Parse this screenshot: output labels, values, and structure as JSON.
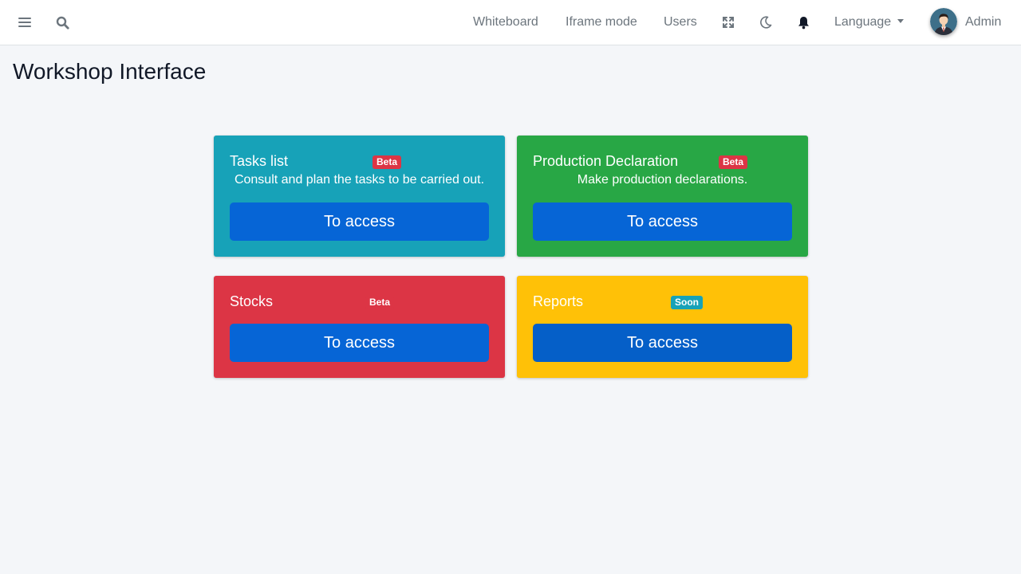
{
  "colors": {
    "info": "#17a2b8",
    "success": "#28a745",
    "danger": "#dc3545",
    "warning": "#ffc107",
    "primary_button": "#0665d6",
    "primary_button_dark": "#055fc8"
  },
  "navbar": {
    "menu_icon": "hamburger-icon",
    "search_icon": "search-icon",
    "links": [
      "Whiteboard",
      "Iframe mode",
      "Users"
    ],
    "fullscreen_icon": "expand-icon",
    "dark_mode_icon": "moon-icon",
    "notifications_icon": "bell-icon",
    "language_label": "Language",
    "user_name": "Admin"
  },
  "page": {
    "title": "Workshop Interface"
  },
  "cards": [
    {
      "title": "Tasks list",
      "badge": "Beta",
      "description": "Consult and plan the tasks to be carried out.",
      "button": "To access"
    },
    {
      "title": "Production Declaration",
      "badge": "Beta",
      "description": "Make production declarations.",
      "button": "To access"
    },
    {
      "title": "Stocks",
      "badge": "Beta",
      "button": "To access"
    },
    {
      "title": "Reports",
      "badge": "Soon",
      "button": "To access"
    }
  ]
}
